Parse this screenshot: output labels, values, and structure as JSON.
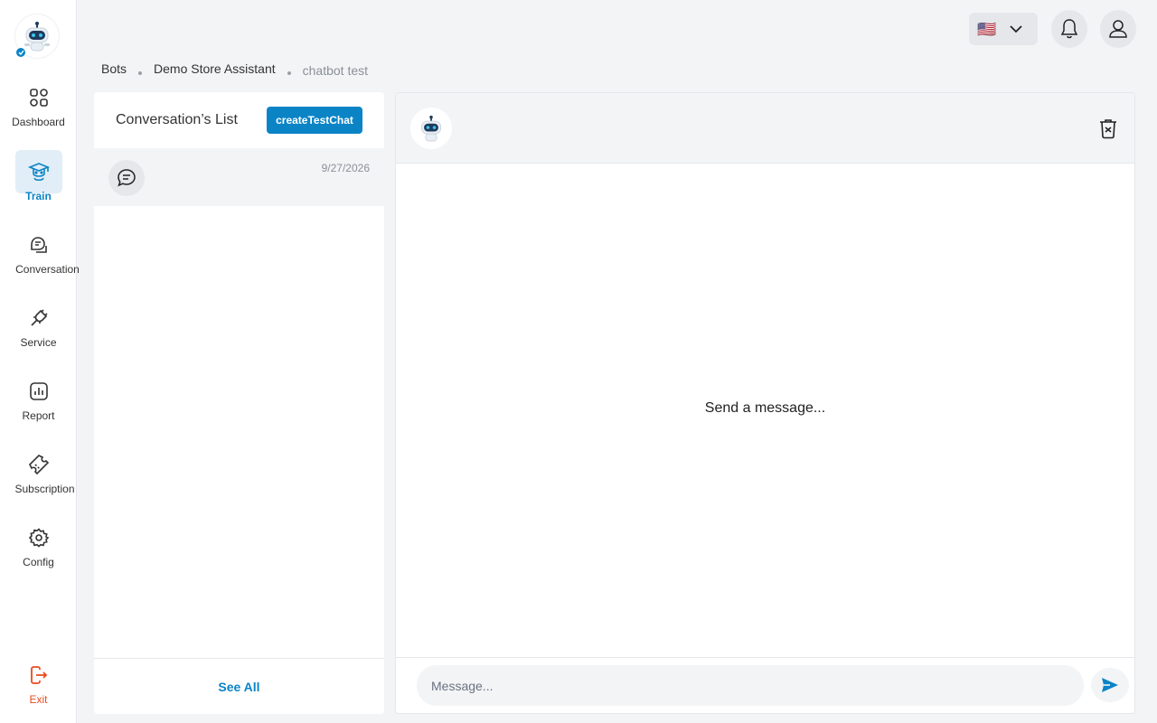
{
  "sidebar": {
    "items": [
      {
        "label": "Dashboard",
        "icon": "dashboard-icon"
      },
      {
        "label": "Train",
        "icon": "train-icon",
        "active": true
      },
      {
        "label": "Conversation",
        "icon": "conversation-icon"
      },
      {
        "label": "Service",
        "icon": "plug-icon"
      },
      {
        "label": "Report",
        "icon": "report-icon"
      },
      {
        "label": "Subscription",
        "icon": "ticket-icon"
      },
      {
        "label": "Config",
        "icon": "gear-icon"
      }
    ],
    "exit_label": "Exit"
  },
  "topbar": {
    "language_flag": "🇺🇸"
  },
  "breadcrumb": {
    "items": [
      "Bots",
      "Demo Store Assistant",
      "chatbot test"
    ]
  },
  "conversations": {
    "title": "Conversation’s List",
    "create_label": "createTestChat",
    "items": [
      {
        "date": "9/27/2026"
      }
    ],
    "see_all_label": "See All"
  },
  "chat": {
    "empty_text": "Send a message...",
    "input_placeholder": "Message..."
  },
  "colors": {
    "accent": "#0b84c6",
    "exit": "#ea4b1e",
    "background": "#f3f4f6"
  }
}
